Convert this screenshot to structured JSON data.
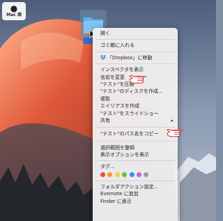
{
  "watermark": {
    "apple": "",
    "brand": "Mac 酒"
  },
  "menu": {
    "groups": [
      [
        "開く"
      ],
      [
        "ゴミ箱に入れる"
      ],
      [
        "「Dropbox」に移動"
      ],
      [
        "インスペクタを表示",
        "名前を変更",
        "\"テスト\"を圧縮",
        "\"テスト\"のディスクを作成...",
        "複製",
        "エイリアスを作成",
        "\"テスト\"をスライドショー",
        "共有"
      ],
      [
        "\"テスト\"のパス名をコピー"
      ],
      [
        "選択範囲を整頓",
        "表示オプションを表示"
      ],
      [
        "タグ..."
      ],
      [
        "フォルダアクション設定...",
        "Evernote に追加",
        "Finder に表示"
      ]
    ],
    "submenu_indicator": "▸",
    "tag_colors": [
      "#e84a43",
      "#f5962e",
      "#f4d23a",
      "#5ac150",
      "#3b8ef0",
      "#b76ad8",
      "#9b9b9b"
    ]
  },
  "colors": {
    "menu_bg": "#eeeef0",
    "text": "#1e1e1e",
    "separator": "#d2d2d4",
    "hand_red": "#d12a2a"
  }
}
